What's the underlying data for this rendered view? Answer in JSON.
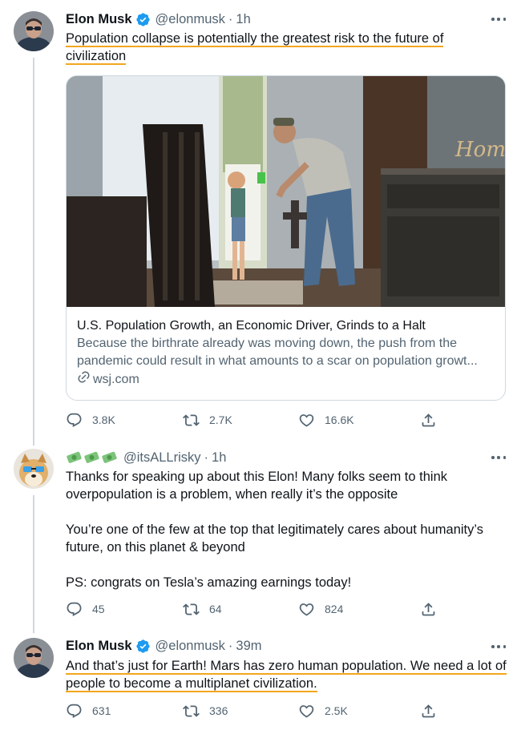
{
  "tweets": [
    {
      "name": "Elon Musk",
      "handle": "@elonmusk",
      "separator": "·",
      "time": "1h",
      "text_lines": [
        "Population collapse is potentially the greatest risk to the future of",
        "civilization"
      ],
      "card": {
        "title": "U.S. Population Growth, an Economic Driver, Grinds to a Halt",
        "description_lines": [
          "Because the birthrate already was moving down, the push from the",
          "pandemic could result in what amounts to a scar on population growt..."
        ],
        "domain": "wsj.com"
      },
      "counts": {
        "replies": "3.8K",
        "retweets": "2.7K",
        "likes": "16.6K"
      }
    },
    {
      "handle": "@itsALLrisky",
      "separator": "·",
      "time": "1h",
      "paragraphs": [
        [
          "Thanks for speaking up about this Elon! Many folks seem to think",
          "overpopulation is a problem, when really it’s the opposite"
        ],
        [
          "You’re one of the few at the top that legitimately cares about humanity’s",
          "future, on this planet & beyond"
        ],
        [
          "PS: congrats on Tesla’s amazing earnings today!"
        ]
      ],
      "counts": {
        "replies": "45",
        "retweets": "64",
        "likes": "824"
      }
    },
    {
      "name": "Elon Musk",
      "handle": "@elonmusk",
      "separator": "·",
      "time": "39m",
      "text_lines": [
        "And that’s just for Earth! Mars has zero human population. We need a lot of",
        "people to become a multiplanet civilization."
      ],
      "counts": {
        "replies": "631",
        "retweets": "336",
        "likes": "2.5K"
      }
    }
  ],
  "colors": {
    "text": "#0f1419",
    "secondary": "#536471",
    "verified": "#1d9bf0",
    "highlight_underline": "#f3a61f",
    "border": "#cfd9de"
  },
  "icons": [
    "verified-badge-icon",
    "more-icon",
    "reply-icon",
    "retweet-icon",
    "like-icon",
    "share-icon",
    "link-icon",
    "money-bag-emoji-icon"
  ]
}
